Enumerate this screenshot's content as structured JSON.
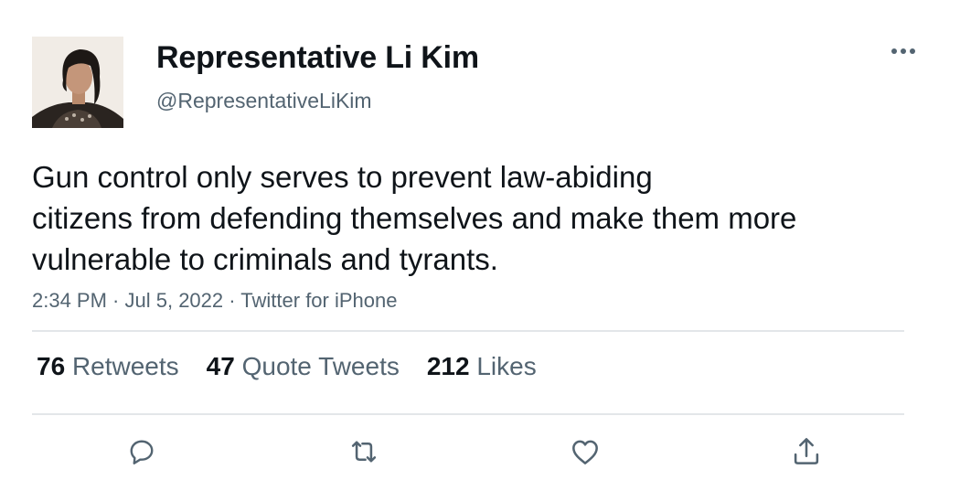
{
  "author": {
    "display_name": "Representative Li Kim",
    "handle": "@RepresentativeLiKim"
  },
  "tweet": {
    "lines": [
      "Gun control only serves to prevent law-abiding",
      "citizens from defending themselves and make them more",
      "vulnerable to criminals and tyrants."
    ],
    "time": "2:34 PM",
    "date": "Jul 5, 2022",
    "source": "Twitter for iPhone",
    "separator": " · "
  },
  "stats": {
    "retweets": {
      "count": "76",
      "label": "Retweets"
    },
    "quotes": {
      "count": "47",
      "label": "Quote Tweets"
    },
    "likes": {
      "count": "212",
      "label": "Likes"
    }
  },
  "actions": [
    "reply-icon",
    "retweet-icon",
    "like-icon",
    "share-icon"
  ],
  "colors": {
    "text": "#0f1419",
    "secondary": "#536471",
    "divider": "#e3e6e9"
  }
}
